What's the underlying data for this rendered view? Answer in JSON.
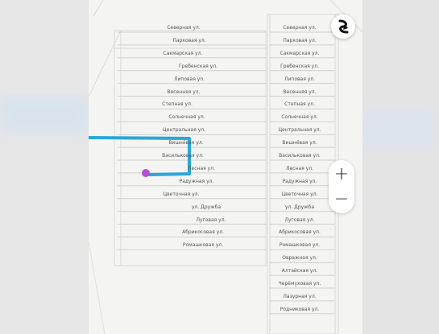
{
  "map": {
    "left_streets": [
      "Северная ул.",
      "Парковая ул.",
      "Сакмарская ул.",
      "Гребенская ул.",
      "Липовая ул.",
      "Весенняя ул.",
      "Степная ул.",
      "Солнечная ул.",
      "Центральная ул.",
      "Вишнёвая ул.",
      "Васильковая ул.",
      "Лесная ул.",
      "Радужная ул.",
      "Цветочная ул.",
      "ул. Дружба",
      "Луговая ул.",
      "Абрикосовая ул.",
      "Ромашковая ул."
    ],
    "right_streets": [
      "Северная ул.",
      "Парковая ул.",
      "Сакмарская ул.",
      "Гребенская ул.",
      "Липовая ул.",
      "Весенняя ул.",
      "Степная ул.",
      "Солнечная ул.",
      "Центральная ул.",
      "Вишнёвая ул.",
      "Васильковая ул.",
      "Лесная ул.",
      "Радужная ул.",
      "Цветочная ул.",
      "ул. Дружба",
      "Луговая ул.",
      "Абрикосовая ул.",
      "Ромашковая ул.",
      "Овражная ул.",
      "Алтайская ул.",
      "Черёмуховая ул.",
      "Лазурная ул.",
      "Родниковая ул."
    ],
    "route_color": "#2aa6d8",
    "marker_color": "#b44fd6"
  },
  "controls": {
    "compass_icon": "compass-icon",
    "zoom_in": "+",
    "zoom_out": "−"
  }
}
